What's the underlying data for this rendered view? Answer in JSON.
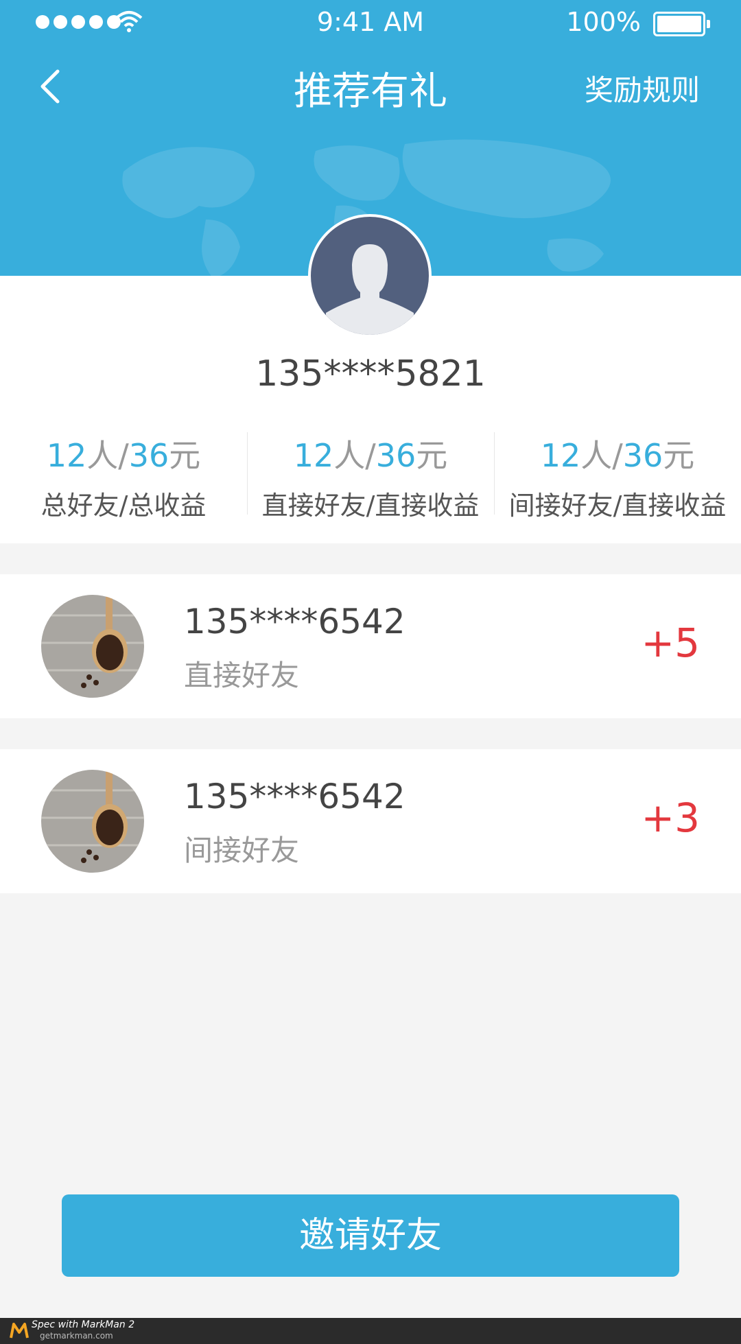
{
  "status_bar": {
    "time": "9:41 AM",
    "battery": "100%"
  },
  "nav": {
    "title": "推荐有礼",
    "rules": "奖励规则"
  },
  "profile": {
    "phone": "135****5821"
  },
  "stats": [
    {
      "count": "12",
      "people_unit": "人",
      "slash": "/",
      "amount": "36",
      "money_unit": "元",
      "label": "总好友/总收益"
    },
    {
      "count": "12",
      "people_unit": "人",
      "slash": "/",
      "amount": "36",
      "money_unit": "元",
      "label": "直接好友/直接收益"
    },
    {
      "count": "12",
      "people_unit": "人",
      "slash": "/",
      "amount": "36",
      "money_unit": "元",
      "label": "间接好友/直接收益"
    }
  ],
  "friends": [
    {
      "phone": "135****6542",
      "type": "直接好友",
      "points": "+5"
    },
    {
      "phone": "135****6542",
      "type": "间接好友",
      "points": "+3"
    }
  ],
  "invite_button": "邀请好友",
  "footer": {
    "line1": "Spec with MarkMan 2",
    "line2": "getmarkman.com"
  },
  "colors": {
    "primary": "#38aedc",
    "points": "#e3383e",
    "text_main": "#444444",
    "text_sub": "#999999"
  }
}
